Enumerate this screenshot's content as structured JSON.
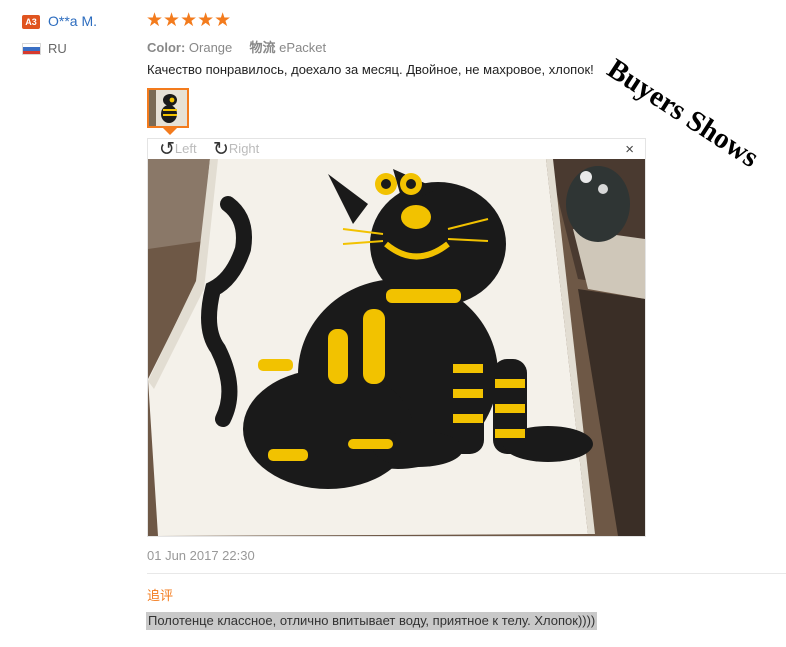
{
  "reviewer": {
    "badge": "A3",
    "name": "O**a M.",
    "country": "RU"
  },
  "rating": {
    "stars_text": "★★★★★",
    "value": 5,
    "max": 5
  },
  "attributes": {
    "color_label": "Color:",
    "color_value": "Orange",
    "shipping_label": "物流",
    "shipping_value": "ePacket"
  },
  "review_text": "Качество понравилось, доехало за месяц. Двойное, не махровое, хлопок!",
  "viewer": {
    "rotate_left_icon": "↺",
    "rotate_left": "Left",
    "rotate_right_icon": "↻",
    "rotate_right": "Right",
    "close": "×"
  },
  "date": "01 Jun 2017 22:30",
  "followup": {
    "label": "追评",
    "text": "Полотенце классное, отлично впитывает воду, приятное к телу. Хлопок))))"
  },
  "watermark": "Buyers Shows",
  "colors": {
    "accent": "#f37b1d",
    "link": "#2d6dbf",
    "badge": "#e0541f"
  }
}
